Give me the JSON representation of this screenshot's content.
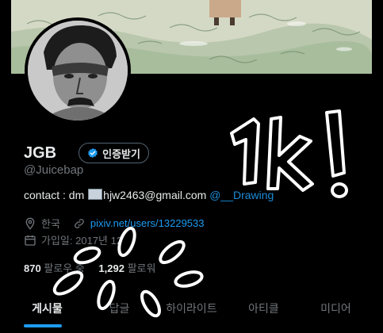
{
  "profile": {
    "display_name": "JGB",
    "handle": "@Juicebap",
    "verify_label": "인증받기",
    "bio_prefix": "contact : dm ",
    "bio_email": "hjw2463@gmail.com",
    "bio_trailing": "  @__Drawing",
    "location": "한국",
    "website": "pixiv.net/users/13229533",
    "joined": "가입일: 2017년 12월",
    "following_count": "870",
    "following_label": "팔로우 중",
    "followers_count": "1,292",
    "followers_label": "팔로워"
  },
  "tabs": [
    {
      "label": "게시물",
      "active": true
    },
    {
      "label": "답글",
      "active": false
    },
    {
      "label": "하이라이트",
      "active": false
    },
    {
      "label": "아티클",
      "active": false
    },
    {
      "label": "미디어",
      "active": false
    }
  ],
  "overlay_text": "1k!",
  "colors": {
    "accent": "#1d9bf0",
    "background": "#000000",
    "muted_text": "#71767b",
    "primary_text": "#e7e9ea"
  },
  "icons": {
    "verified": "verified-badge-icon",
    "location": "location-pin-icon",
    "link": "link-icon",
    "calendar": "calendar-icon",
    "mail": "envelope-emoji-icon"
  }
}
